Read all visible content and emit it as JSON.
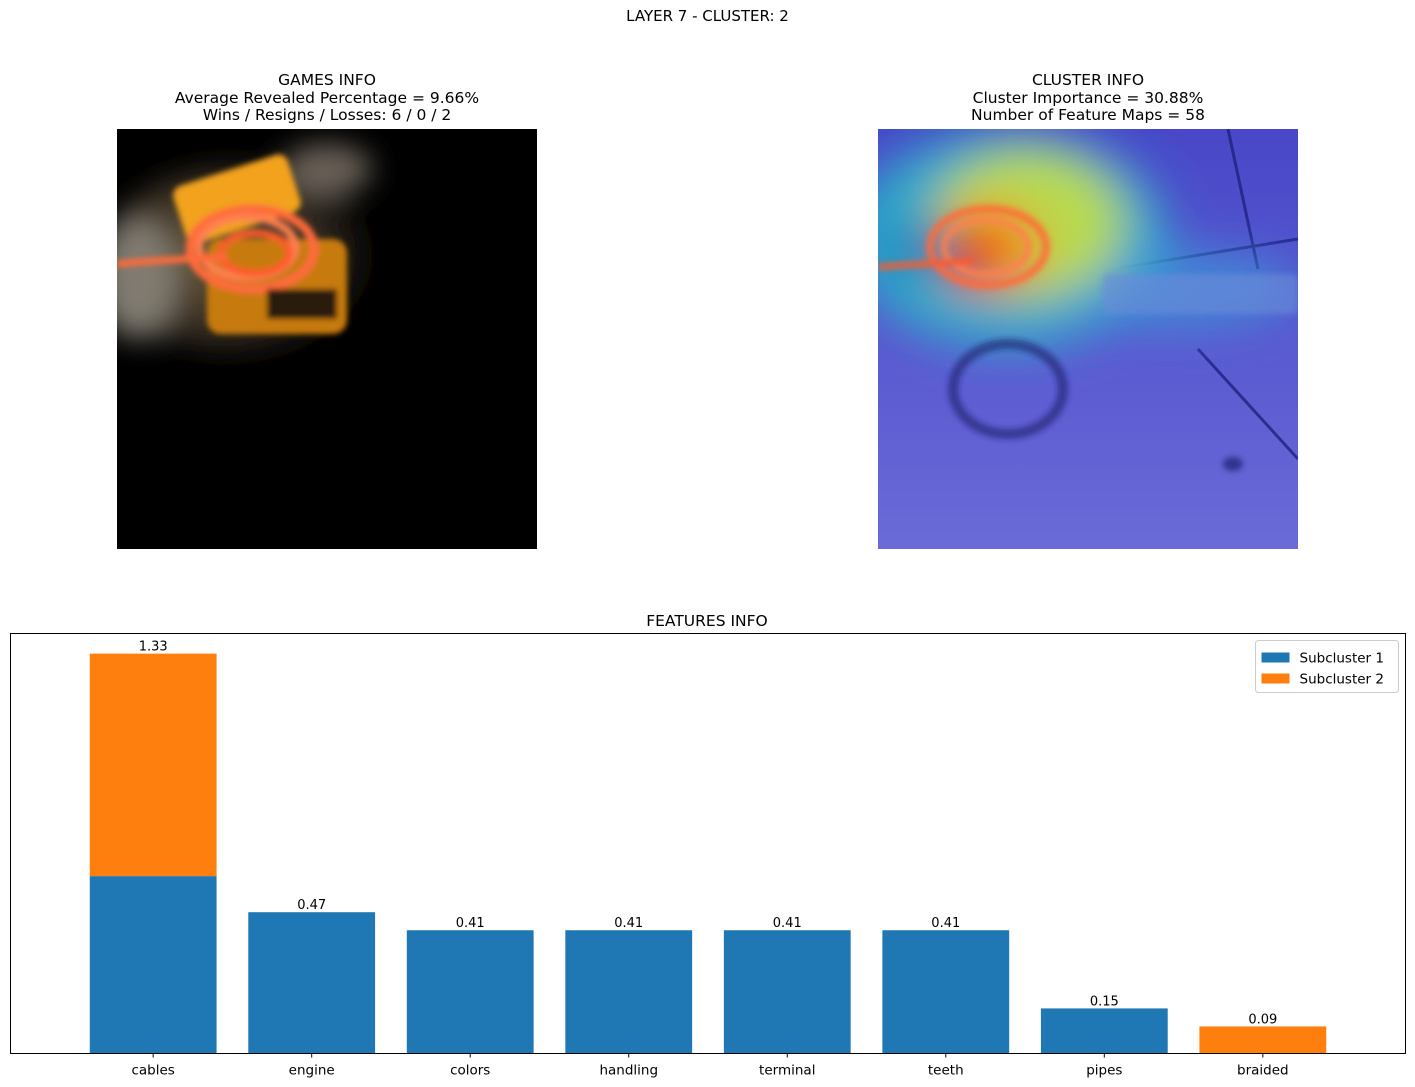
{
  "figure": {
    "title": "LAYER 7 - CLUSTER: 2"
  },
  "games_info": {
    "title": "GAMES INFO",
    "line1": "Average Revealed Percentage = 9.66%",
    "line2": "Wins / Resigns / Losses: 6 / 0 / 2"
  },
  "cluster_info": {
    "title": "CLUSTER INFO",
    "line1": "Cluster Importance = 30.88%",
    "line2": "Number of Feature Maps = 58"
  },
  "colors": {
    "subcluster_1": "#1f77b4",
    "subcluster_2": "#ff7f0e"
  },
  "chart_data": {
    "type": "bar",
    "stacked": true,
    "title": "FEATURES INFO",
    "xlabel": "",
    "ylabel": "",
    "categories": [
      "cables",
      "engine",
      "colors",
      "handling",
      "terminal",
      "teeth",
      "pipes",
      "braided"
    ],
    "series": [
      {
        "name": "Subcluster 1",
        "color": "#1f77b4",
        "values": [
          0.59,
          0.47,
          0.41,
          0.41,
          0.41,
          0.41,
          0.15,
          0
        ]
      },
      {
        "name": "Subcluster 2",
        "color": "#ff7f0e",
        "values": [
          0.74,
          0,
          0,
          0,
          0,
          0,
          0,
          0.09
        ]
      }
    ],
    "totals": [
      1.33,
      0.47,
      0.41,
      0.41,
      0.41,
      0.41,
      0.15,
      0.09
    ],
    "total_labels": [
      "1.33",
      "0.47",
      "0.41",
      "0.41",
      "0.41",
      "0.41",
      "0.15",
      "0.09"
    ],
    "ylim": [
      0,
      1.397
    ],
    "y_ticks_visible": false,
    "grid": false,
    "legend": "top-right"
  }
}
